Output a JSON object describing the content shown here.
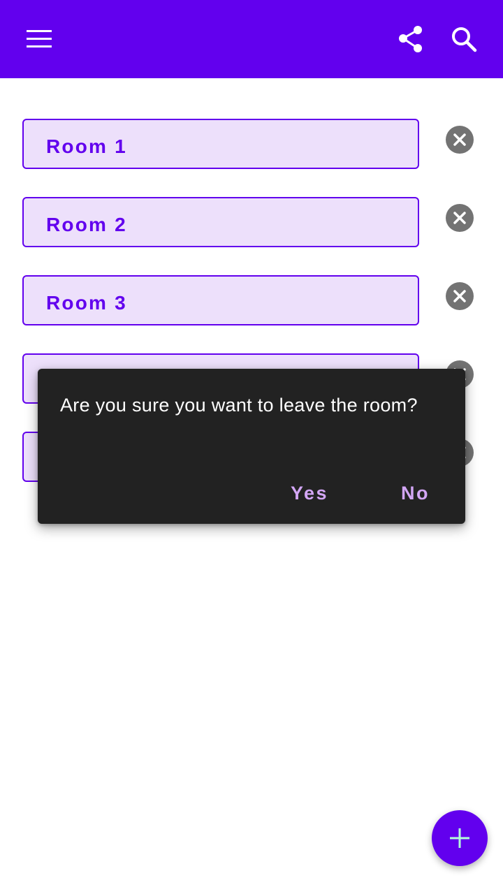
{
  "appbar": {
    "color": "#6200ee",
    "icons": [
      "menu-icon",
      "share-icon",
      "search-icon"
    ]
  },
  "rooms": [
    {
      "label": "Room 1"
    },
    {
      "label": "Room 2"
    },
    {
      "label": "Room 3"
    },
    {
      "label": ""
    },
    {
      "label": ""
    }
  ],
  "dialog": {
    "message": "Are you sure you want to leave the room?",
    "yes_label": "Yes",
    "no_label": "No"
  },
  "fab": {
    "icon": "add-icon",
    "icon_color": "#b3ffd9"
  },
  "colors": {
    "primary": "#6200ee",
    "field_background": "#ede0fb",
    "dialog_background": "#222222",
    "dialog_action": "#d3a6f5",
    "remove_icon": "#737373"
  }
}
